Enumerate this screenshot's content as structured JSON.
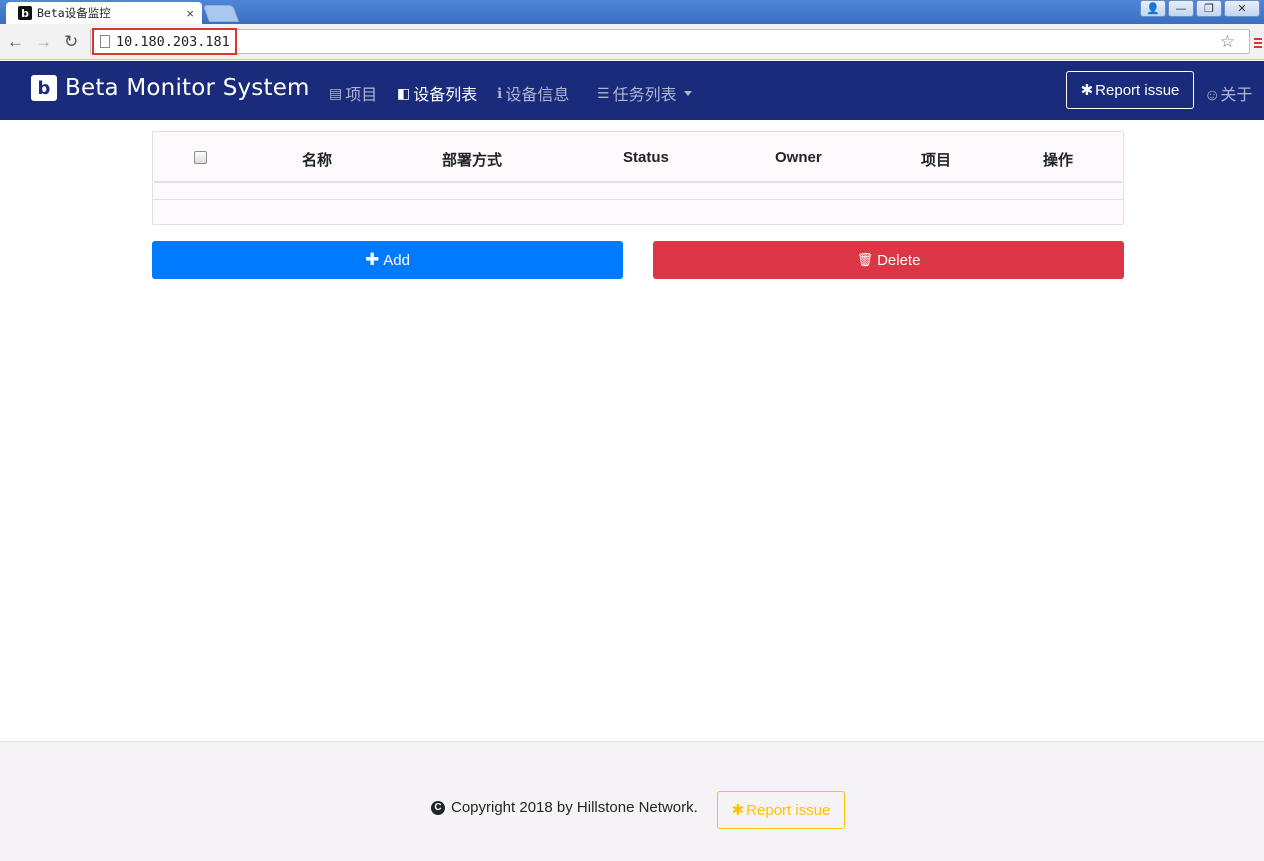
{
  "browser": {
    "tab_title": "Beta设备监控",
    "tab_close": "×",
    "url": "10.180.203.181",
    "back_icon": "←",
    "forward_icon": "→",
    "reload_icon": "↻",
    "star_icon": "☆",
    "window_controls": [
      "👤",
      "—",
      "❐",
      "✕"
    ]
  },
  "navbar": {
    "brand_logo": "b",
    "brand_name": "Beta Monitor System",
    "items": [
      {
        "icon": "▤",
        "label": "项目"
      },
      {
        "icon": "◧",
        "label": "设备列表"
      },
      {
        "icon": "ℹ",
        "label": "设备信息"
      },
      {
        "icon": "☰",
        "label": "任务列表"
      }
    ],
    "report_icon": "✱",
    "report_label": "Report issue",
    "about_icon": "☺",
    "about_label": "关于"
  },
  "table": {
    "columns": [
      "名称",
      "部署方式",
      "Status",
      "Owner",
      "项目",
      "操作"
    ],
    "rows": []
  },
  "actions": {
    "add_icon": "✚",
    "add_label": "Add",
    "delete_icon": "🗑",
    "delete_label": "Delete"
  },
  "footer": {
    "copyright_icon": "C",
    "copyright_text": "Copyright 2018 by Hillstone Network.",
    "report_icon": "✱",
    "report_label": "Report issue"
  },
  "colors": {
    "navbar": "#1a2b7c",
    "add_button": "#007bff",
    "delete_button": "#dc3545",
    "footer_report": "#ffc107"
  }
}
